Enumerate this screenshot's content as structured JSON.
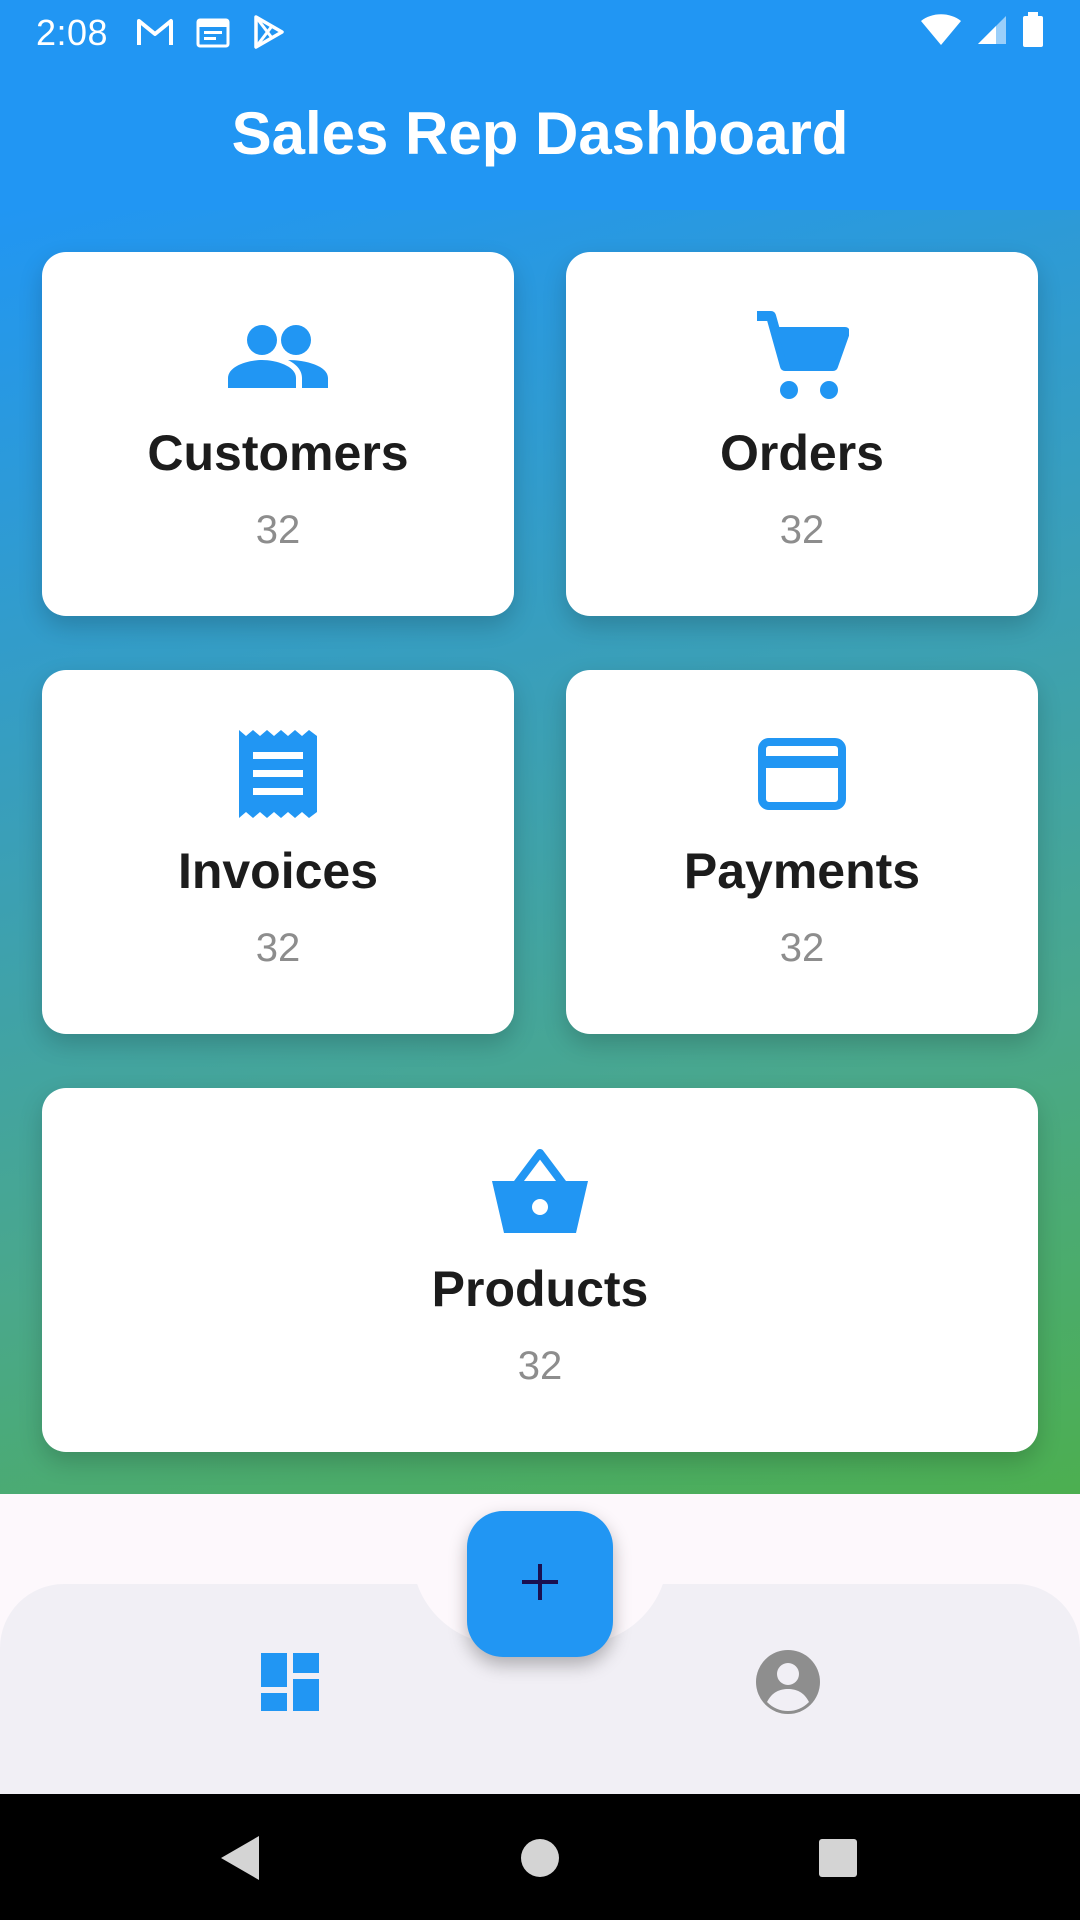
{
  "status_bar": {
    "time": "2:08",
    "left_icons": [
      "gmail-icon",
      "calendar-icon",
      "play-store-icon"
    ],
    "right_icons": [
      "wifi-icon",
      "signal-icon",
      "battery-icon"
    ]
  },
  "app_bar": {
    "title": "Sales Rep Dashboard"
  },
  "cards": {
    "customers": {
      "label": "Customers",
      "count": "32",
      "icon": "people-icon"
    },
    "orders": {
      "label": "Orders",
      "count": "32",
      "icon": "cart-icon"
    },
    "invoices": {
      "label": "Invoices",
      "count": "32",
      "icon": "receipt-icon"
    },
    "payments": {
      "label": "Payments",
      "count": "32",
      "icon": "credit-card-icon"
    },
    "products": {
      "label": "Products",
      "count": "32",
      "icon": "basket-icon"
    }
  },
  "bottom_nav": {
    "items": [
      {
        "icon": "dashboard-icon",
        "active": true
      },
      {
        "icon": "account-circle-icon",
        "active": false
      }
    ],
    "fab_icon": "plus-icon"
  },
  "system_nav": [
    "back-icon",
    "home-icon",
    "recents-icon"
  ],
  "colors": {
    "primary": "#2196F3",
    "gradient_end": "#4CAF50",
    "text_dark": "#1c1c1c",
    "text_muted": "#8d8d8d",
    "inactive_icon": "#8e8e8e",
    "fab_icon": "#1a1050"
  }
}
